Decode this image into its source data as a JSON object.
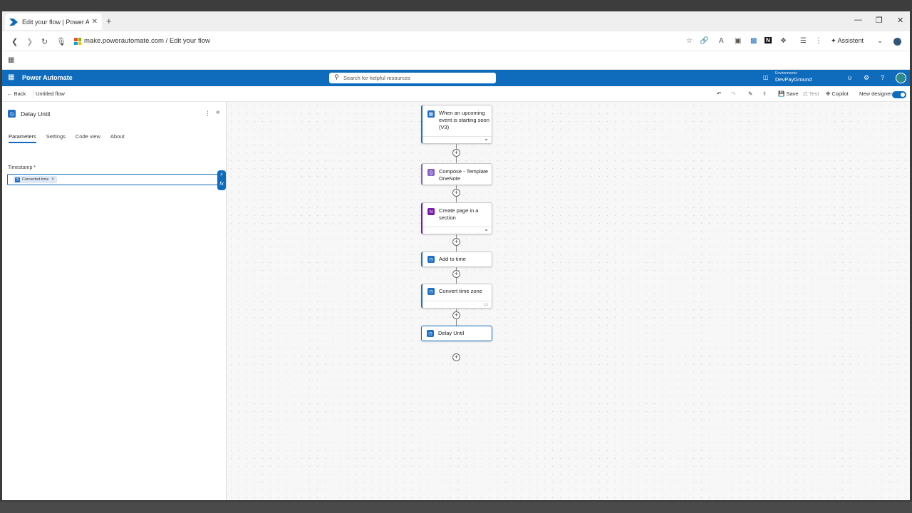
{
  "browser": {
    "tab_title": "Edit your flow | Power Autom",
    "new_tab": "+",
    "url": "make.powerautomate.com / Edit your flow",
    "assistant_label": "Assistent",
    "controls": {
      "minimize": "—",
      "restore": "❐",
      "close": "✕"
    }
  },
  "app": {
    "name": "Power Automate",
    "search_placeholder": "Search for helpful resources",
    "environment_label": "Environments",
    "environment_value": "DevPayGround"
  },
  "command_bar": {
    "back": "Back",
    "flow_name": "Untitled flow",
    "save": "Save",
    "test": "Test",
    "copilot": "Copilot",
    "new_designer": "New designer"
  },
  "panel": {
    "title": "Delay Until",
    "tabs": [
      "Parameters",
      "Settings",
      "Code view",
      "About"
    ],
    "field_label": "Timestamp *",
    "token": "Converted time",
    "token_remove": "×",
    "tool_bolt": "⚡",
    "tool_fx": "fx"
  },
  "flow": {
    "nodes": [
      {
        "title": "When an upcoming event is starting soon (V3)",
        "icon_color": "#1f6fc5",
        "icon": "▦"
      },
      {
        "title": "Compose - Template OneNote",
        "icon_color": "#8661c5",
        "icon": "{}"
      },
      {
        "title": "Create page in a section",
        "icon_color": "#7719aa",
        "icon": "N"
      },
      {
        "title": "Add to time",
        "icon_color": "#1f6fc5",
        "icon": "◷"
      },
      {
        "title": "Convert time zone",
        "icon_color": "#1f6fc5",
        "icon": "◷"
      },
      {
        "title": "Delay Until",
        "icon_color": "#1f6fc5",
        "icon": "◷"
      }
    ],
    "add_symbol": "+",
    "link_icon": "⚭",
    "comment_icon": "▭"
  }
}
